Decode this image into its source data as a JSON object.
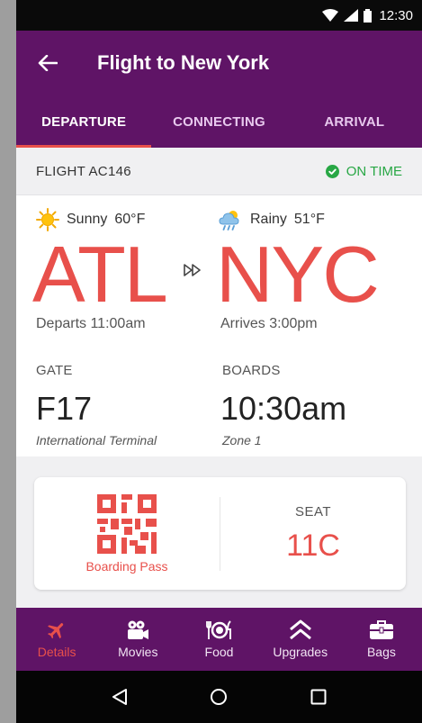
{
  "status_bar": {
    "time": "12:30"
  },
  "app_bar": {
    "title": "Flight to New York"
  },
  "tabs": [
    {
      "label": "DEPARTURE",
      "active": true
    },
    {
      "label": "CONNECTING",
      "active": false
    },
    {
      "label": "ARRIVAL",
      "active": false
    }
  ],
  "flight": {
    "number": "FLIGHT AC146",
    "status": "ON TIME"
  },
  "departure": {
    "weather": "Sunny",
    "temp": "60°F",
    "weather_icon": "sun-icon",
    "code": "ATL",
    "time": "Departs 11:00am",
    "gate_label": "GATE",
    "gate": "F17",
    "terminal": "International Terminal"
  },
  "arrival": {
    "weather": "Rainy",
    "temp": "51°F",
    "weather_icon": "rain-cloud-icon",
    "code": "NYC",
    "time": "Arrives 3:00pm",
    "boards_label": "BOARDS",
    "boards": "10:30am",
    "zone": "Zone 1"
  },
  "boarding": {
    "label": "Boarding Pass",
    "seat_label": "SEAT",
    "seat": "11C"
  },
  "bottom_nav": [
    {
      "label": "Details",
      "icon": "plane-icon",
      "active": true
    },
    {
      "label": "Movies",
      "icon": "movie-camera-icon",
      "active": false
    },
    {
      "label": "Food",
      "icon": "dining-icon",
      "active": false
    },
    {
      "label": "Upgrades",
      "icon": "upgrade-chevrons-icon",
      "active": false
    },
    {
      "label": "Bags",
      "icon": "suitcase-icon",
      "active": false
    }
  ],
  "colors": {
    "primary": "#5f1466",
    "accent": "#e8504b",
    "success": "#28a745"
  }
}
